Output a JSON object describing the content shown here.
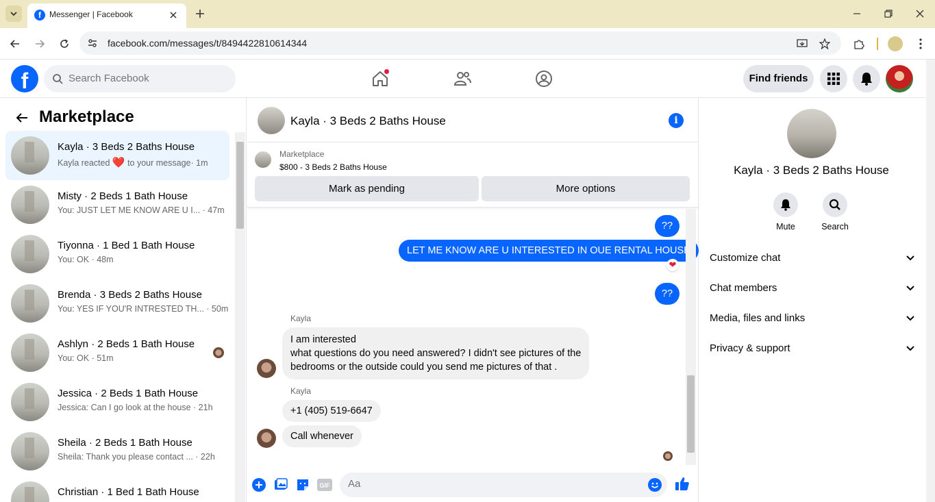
{
  "browser": {
    "tab_title": "Messenger | Facebook",
    "url": "facebook.com/messages/t/8494422810614344"
  },
  "header": {
    "search_placeholder": "Search Facebook",
    "find_friends_label": "Find friends",
    "logo_letter": "f"
  },
  "sidebar": {
    "title": "Marketplace",
    "conversations": [
      {
        "name": "Kayla · 3 Beds 2 Baths House",
        "snippet_before": "Kayla reacted ",
        "snippet_after": " to your message",
        "time": "· 1m",
        "active": true
      },
      {
        "name": "Misty · 2 Beds 1 Bath House",
        "snippet": "You: JUST LET ME KNOW ARE U I...",
        "time": "· 47m"
      },
      {
        "name": "Tiyonna · 1 Bed 1 Bath House",
        "snippet": "You: OK",
        "time": "· 48m"
      },
      {
        "name": "Brenda · 3 Beds 2 Baths House",
        "snippet": "You: YES IF YOU'R INTRESTED TH...",
        "time": "· 50m"
      },
      {
        "name": "Ashlyn · 2 Beds 1 Bath House",
        "snippet": "You: OK",
        "time": "· 51m"
      },
      {
        "name": "Jessica · 2 Beds 1 Bath House",
        "snippet": "Jessica: Can I go look at the house",
        "time": "· 21h"
      },
      {
        "name": "Sheila · 2 Beds 1 Bath House",
        "snippet": "Sheila: Thank you please contact ...",
        "time": "· 22h"
      },
      {
        "name": "Christian · 1 Bed 1 Bath House",
        "snippet": "",
        "time": ""
      }
    ]
  },
  "chat": {
    "title": "Kayla · 3 Beds 2 Baths House",
    "marketplace_label": "Marketplace",
    "listing": "$800 - 3 Beds 2 Baths House",
    "mark_pending_label": "Mark as pending",
    "more_options_label": "More options",
    "messages": {
      "out1": "??",
      "out2": "LET ME KNOW ARE U INTERESTED IN OUE RENTAL HOUSE",
      "out3": "??",
      "sender1": "Kayla",
      "in1_line1": "I am interested",
      "in1_line2": "what questions do you need answered? I didn't see pictures of the",
      "in1_line3": "bedrooms or the outside could you send me pictures of that .",
      "sender2": "Kayla",
      "in2": "+1 (405) 519-6647",
      "in3": "Call whenever"
    },
    "composer_placeholder": "Aa"
  },
  "info_panel": {
    "name": "Kayla · 3 Beds 2 Baths House",
    "mute_label": "Mute",
    "search_label": "Search",
    "rows": [
      "Customize chat",
      "Chat members",
      "Media, files and links",
      "Privacy & support"
    ]
  },
  "colors": {
    "brand": "#0866ff",
    "active_row": "#ebf5ff",
    "reaction": "#e41e3f"
  }
}
